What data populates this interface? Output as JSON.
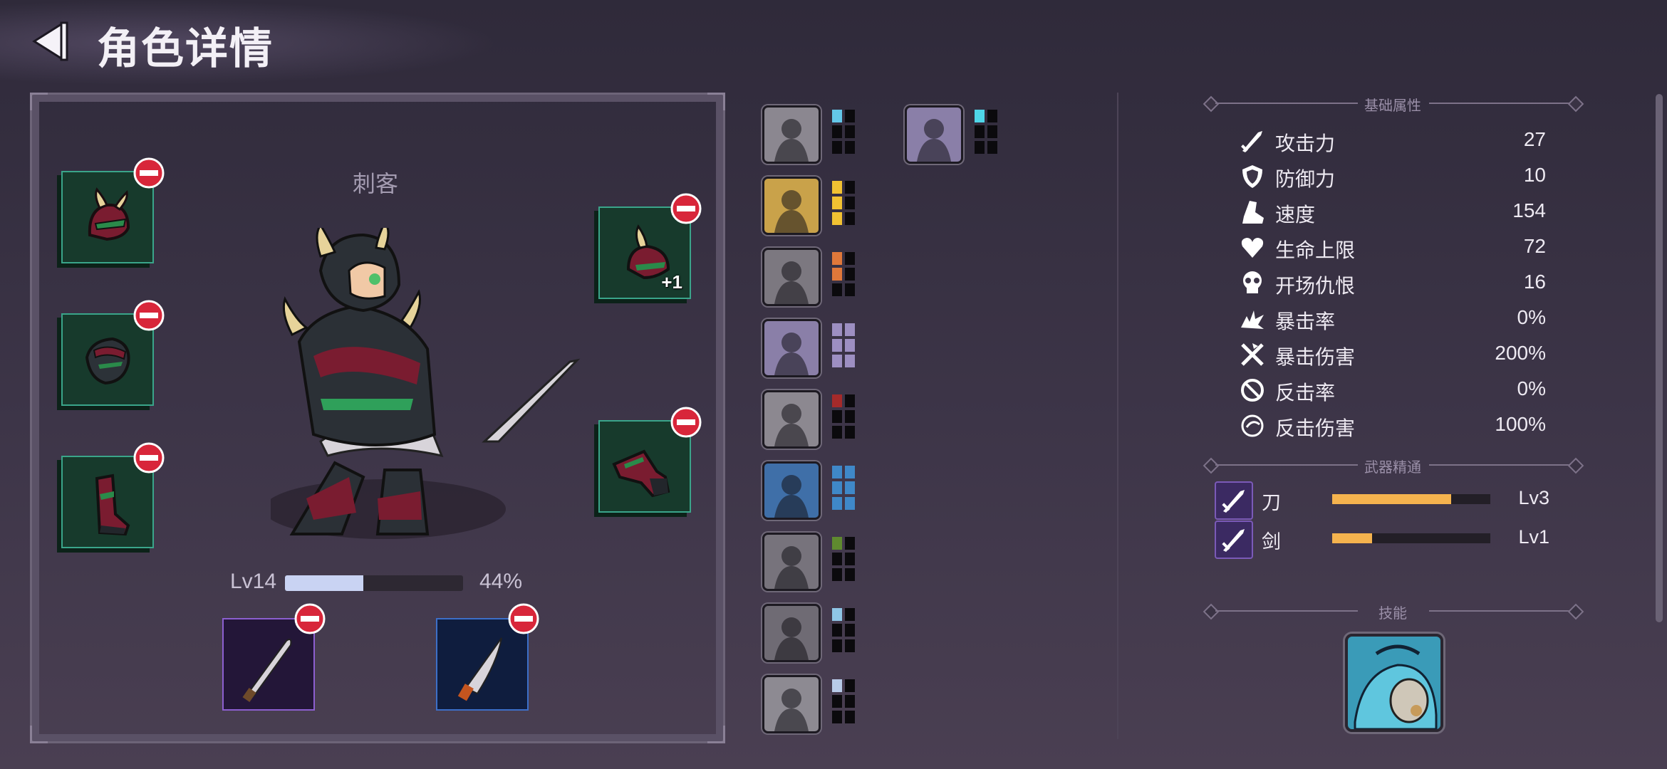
{
  "header": {
    "title": "角色详情"
  },
  "character": {
    "class_name": "刺客",
    "level": "Lv14",
    "exp_percent": "44%",
    "exp_fraction": 0.44,
    "armor_badge": "+1"
  },
  "traits": {
    "column1": [
      {
        "icon": "fist-raise-icon",
        "pip_color": "#63c7e8",
        "filled": 1
      },
      {
        "icon": "dagger-warrior-icon",
        "pip_color": "#f1c232",
        "filled": 3
      },
      {
        "icon": "shadow-figure-icon",
        "pip_color": "#e0783a",
        "filled": 2
      },
      {
        "icon": "armored-knight-icon",
        "pip_color": "#9d8fc2",
        "filled": 6
      },
      {
        "icon": "sun-head-icon",
        "pip_color": "#a52a2a",
        "filled": 1
      },
      {
        "icon": "punching-viking-icon",
        "pip_color": "#3f88c8",
        "filled": 6
      },
      {
        "icon": "horned-helmet-icon",
        "pip_color": "#5f8a2f",
        "filled": 1
      },
      {
        "icon": "gargoyle-icon",
        "pip_color": "#8fc6e6",
        "filled": 1
      },
      {
        "icon": "compass-shield-icon",
        "pip_color": "#b8cbe8",
        "filled": 1
      }
    ],
    "column2": [
      {
        "icon": "crystal-ghost-icon",
        "pip_color": "#4fd6e8",
        "filled": 1
      }
    ]
  },
  "attributes": {
    "section_title": "基础属性",
    "items": [
      {
        "name": "攻击力",
        "value": "27",
        "icon": "sword-icon"
      },
      {
        "name": "防御力",
        "value": "10",
        "icon": "shield-icon"
      },
      {
        "name": "速度",
        "value": "154",
        "icon": "boot-icon"
      },
      {
        "name": "生命上限",
        "value": "72",
        "icon": "heart-icon"
      },
      {
        "name": "开场仇恨",
        "value": "16",
        "icon": "skull-icon"
      },
      {
        "name": "暴击率",
        "value": "0%",
        "icon": "crit-burst-icon"
      },
      {
        "name": "暴击伤害",
        "value": "200%",
        "icon": "crossed-swords-icon"
      },
      {
        "name": "反击率",
        "value": "0%",
        "icon": "counter-icon"
      },
      {
        "name": "反击伤害",
        "value": "100%",
        "icon": "counter-damage-icon"
      }
    ]
  },
  "weapon_mastery": {
    "section_title": "武器精通",
    "items": [
      {
        "name": "刀",
        "level": "Lv3",
        "progress": 0.75
      },
      {
        "name": "剑",
        "level": "Lv1",
        "progress": 0.25
      }
    ]
  },
  "skills": {
    "section_title": "技能",
    "icon": "blue-creature-skill-icon"
  },
  "colors": {
    "slot_bg": "#173a2c",
    "slot_border": "#3aa58a",
    "remove_red": "#d8263a",
    "exp_fill": "#c9d3f3",
    "mastery_fill": "#f5b34e"
  }
}
